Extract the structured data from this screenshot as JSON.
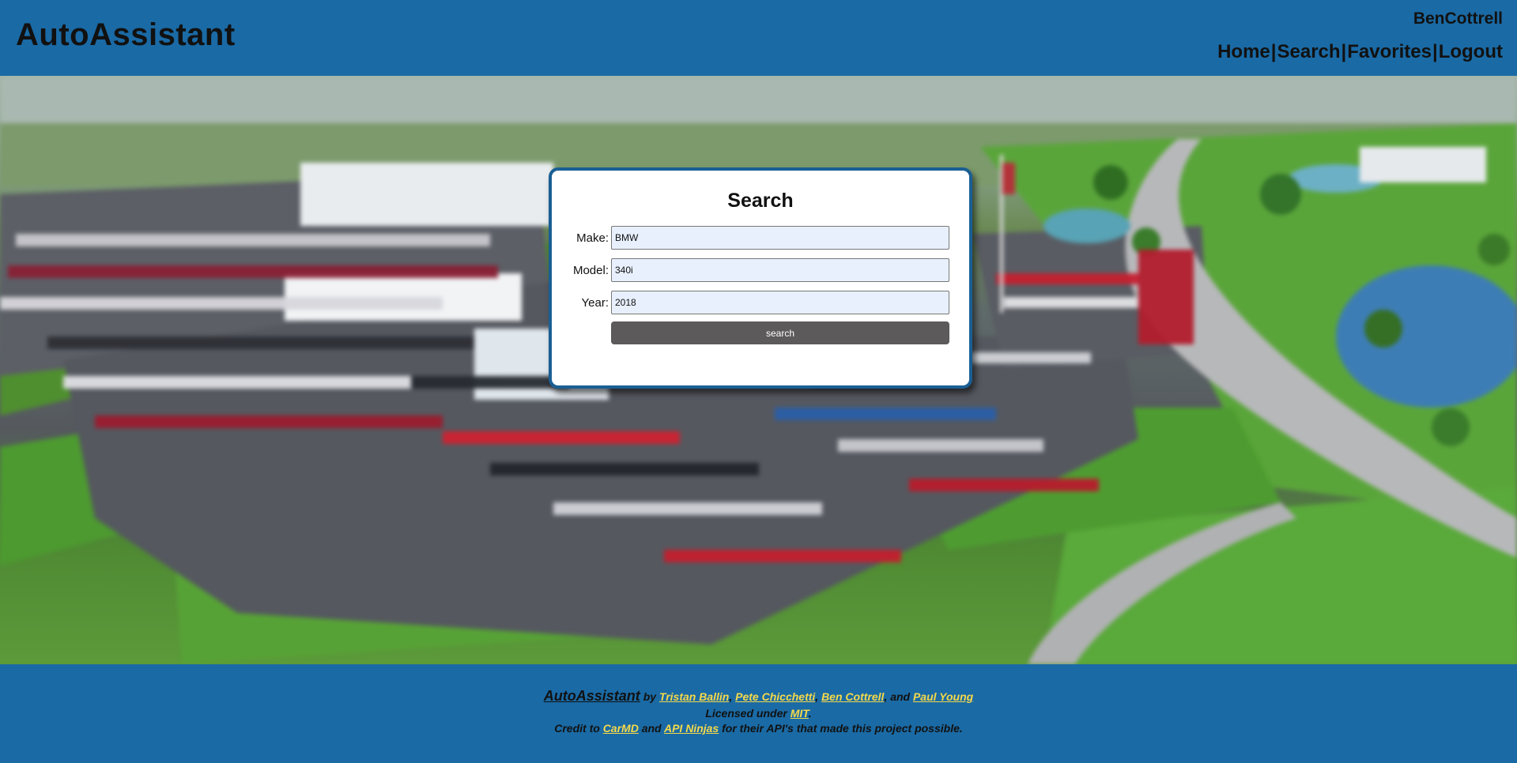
{
  "header": {
    "brand": "AutoAssistant",
    "username": "BenCottrell",
    "nav": {
      "home": "Home",
      "search": "Search",
      "favorites": "Favorites",
      "logout": "Logout",
      "separator": "|"
    }
  },
  "search_card": {
    "title": "Search",
    "make_label": "Make:",
    "make_value": "BMW",
    "model_label": "Model:",
    "model_value": "340i",
    "year_label": "Year:",
    "year_value": "2018",
    "button_label": "search"
  },
  "footer": {
    "app_name": "AutoAssistant",
    "by": "by",
    "authors": [
      "Tristan Ballin",
      "Pete Chicchetti",
      "Ben Cottrell",
      "Paul Young"
    ],
    "comma": ",",
    "and": "and",
    "licensed_text": "Licensed under",
    "license": "MIT",
    "period": ".",
    "credit_text": "Credit to",
    "credit_1": "CarMD",
    "credit_2": "API Ninjas",
    "credit_tail": "for their API's that made this project possible."
  },
  "colors": {
    "header_bg": "#1a6aa5",
    "link_yellow": "#f5d94a",
    "button_bg": "#5d5a5b",
    "card_border": "#1a5f94"
  }
}
